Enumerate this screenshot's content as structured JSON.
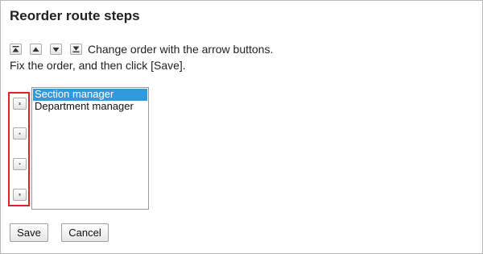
{
  "page": {
    "title": "Reorder route steps",
    "instruction_line1": "Change order with the arrow buttons.",
    "instruction_line2": "Fix the order, and then click [Save]."
  },
  "order_buttons": {
    "icons": [
      "move-to-top-icon",
      "move-up-icon",
      "move-down-icon",
      "move-to-bottom-icon"
    ],
    "highlight_color": "#e0222b"
  },
  "route_steps": {
    "items": [
      {
        "label": "Section manager",
        "selected": true
      },
      {
        "label": "Department manager",
        "selected": false
      }
    ],
    "selected_color": "#3399dd"
  },
  "actions": {
    "save_label": "Save",
    "cancel_label": "Cancel"
  }
}
